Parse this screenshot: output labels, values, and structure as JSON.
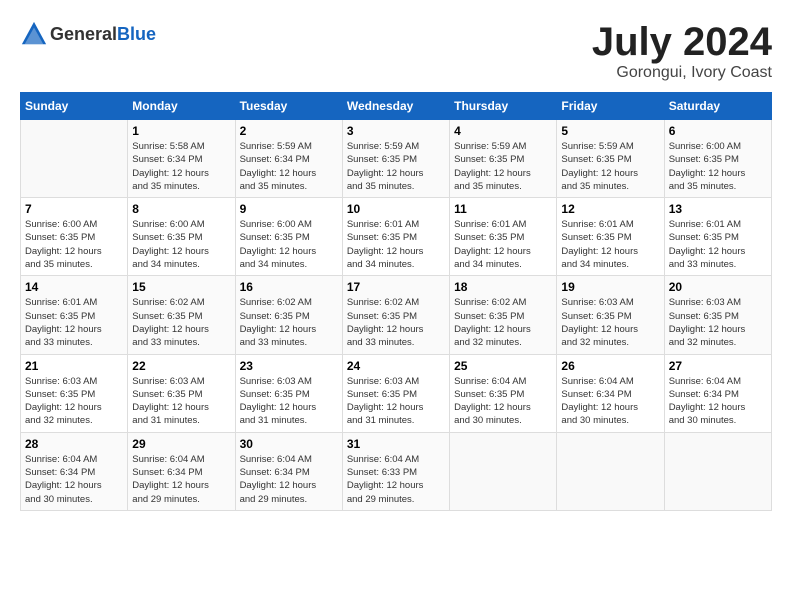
{
  "header": {
    "logo_general": "General",
    "logo_blue": "Blue",
    "month_year": "July 2024",
    "location": "Gorongui, Ivory Coast"
  },
  "calendar": {
    "days_of_week": [
      "Sunday",
      "Monday",
      "Tuesday",
      "Wednesday",
      "Thursday",
      "Friday",
      "Saturday"
    ],
    "weeks": [
      [
        {
          "day": "",
          "info": ""
        },
        {
          "day": "1",
          "info": "Sunrise: 5:58 AM\nSunset: 6:34 PM\nDaylight: 12 hours\nand 35 minutes."
        },
        {
          "day": "2",
          "info": "Sunrise: 5:59 AM\nSunset: 6:34 PM\nDaylight: 12 hours\nand 35 minutes."
        },
        {
          "day": "3",
          "info": "Sunrise: 5:59 AM\nSunset: 6:35 PM\nDaylight: 12 hours\nand 35 minutes."
        },
        {
          "day": "4",
          "info": "Sunrise: 5:59 AM\nSunset: 6:35 PM\nDaylight: 12 hours\nand 35 minutes."
        },
        {
          "day": "5",
          "info": "Sunrise: 5:59 AM\nSunset: 6:35 PM\nDaylight: 12 hours\nand 35 minutes."
        },
        {
          "day": "6",
          "info": "Sunrise: 6:00 AM\nSunset: 6:35 PM\nDaylight: 12 hours\nand 35 minutes."
        }
      ],
      [
        {
          "day": "7",
          "info": "Sunrise: 6:00 AM\nSunset: 6:35 PM\nDaylight: 12 hours\nand 35 minutes."
        },
        {
          "day": "8",
          "info": "Sunrise: 6:00 AM\nSunset: 6:35 PM\nDaylight: 12 hours\nand 34 minutes."
        },
        {
          "day": "9",
          "info": "Sunrise: 6:00 AM\nSunset: 6:35 PM\nDaylight: 12 hours\nand 34 minutes."
        },
        {
          "day": "10",
          "info": "Sunrise: 6:01 AM\nSunset: 6:35 PM\nDaylight: 12 hours\nand 34 minutes."
        },
        {
          "day": "11",
          "info": "Sunrise: 6:01 AM\nSunset: 6:35 PM\nDaylight: 12 hours\nand 34 minutes."
        },
        {
          "day": "12",
          "info": "Sunrise: 6:01 AM\nSunset: 6:35 PM\nDaylight: 12 hours\nand 34 minutes."
        },
        {
          "day": "13",
          "info": "Sunrise: 6:01 AM\nSunset: 6:35 PM\nDaylight: 12 hours\nand 33 minutes."
        }
      ],
      [
        {
          "day": "14",
          "info": "Sunrise: 6:01 AM\nSunset: 6:35 PM\nDaylight: 12 hours\nand 33 minutes."
        },
        {
          "day": "15",
          "info": "Sunrise: 6:02 AM\nSunset: 6:35 PM\nDaylight: 12 hours\nand 33 minutes."
        },
        {
          "day": "16",
          "info": "Sunrise: 6:02 AM\nSunset: 6:35 PM\nDaylight: 12 hours\nand 33 minutes."
        },
        {
          "day": "17",
          "info": "Sunrise: 6:02 AM\nSunset: 6:35 PM\nDaylight: 12 hours\nand 33 minutes."
        },
        {
          "day": "18",
          "info": "Sunrise: 6:02 AM\nSunset: 6:35 PM\nDaylight: 12 hours\nand 32 minutes."
        },
        {
          "day": "19",
          "info": "Sunrise: 6:03 AM\nSunset: 6:35 PM\nDaylight: 12 hours\nand 32 minutes."
        },
        {
          "day": "20",
          "info": "Sunrise: 6:03 AM\nSunset: 6:35 PM\nDaylight: 12 hours\nand 32 minutes."
        }
      ],
      [
        {
          "day": "21",
          "info": "Sunrise: 6:03 AM\nSunset: 6:35 PM\nDaylight: 12 hours\nand 32 minutes."
        },
        {
          "day": "22",
          "info": "Sunrise: 6:03 AM\nSunset: 6:35 PM\nDaylight: 12 hours\nand 31 minutes."
        },
        {
          "day": "23",
          "info": "Sunrise: 6:03 AM\nSunset: 6:35 PM\nDaylight: 12 hours\nand 31 minutes."
        },
        {
          "day": "24",
          "info": "Sunrise: 6:03 AM\nSunset: 6:35 PM\nDaylight: 12 hours\nand 31 minutes."
        },
        {
          "day": "25",
          "info": "Sunrise: 6:04 AM\nSunset: 6:35 PM\nDaylight: 12 hours\nand 30 minutes."
        },
        {
          "day": "26",
          "info": "Sunrise: 6:04 AM\nSunset: 6:34 PM\nDaylight: 12 hours\nand 30 minutes."
        },
        {
          "day": "27",
          "info": "Sunrise: 6:04 AM\nSunset: 6:34 PM\nDaylight: 12 hours\nand 30 minutes."
        }
      ],
      [
        {
          "day": "28",
          "info": "Sunrise: 6:04 AM\nSunset: 6:34 PM\nDaylight: 12 hours\nand 30 minutes."
        },
        {
          "day": "29",
          "info": "Sunrise: 6:04 AM\nSunset: 6:34 PM\nDaylight: 12 hours\nand 29 minutes."
        },
        {
          "day": "30",
          "info": "Sunrise: 6:04 AM\nSunset: 6:34 PM\nDaylight: 12 hours\nand 29 minutes."
        },
        {
          "day": "31",
          "info": "Sunrise: 6:04 AM\nSunset: 6:33 PM\nDaylight: 12 hours\nand 29 minutes."
        },
        {
          "day": "",
          "info": ""
        },
        {
          "day": "",
          "info": ""
        },
        {
          "day": "",
          "info": ""
        }
      ]
    ]
  }
}
